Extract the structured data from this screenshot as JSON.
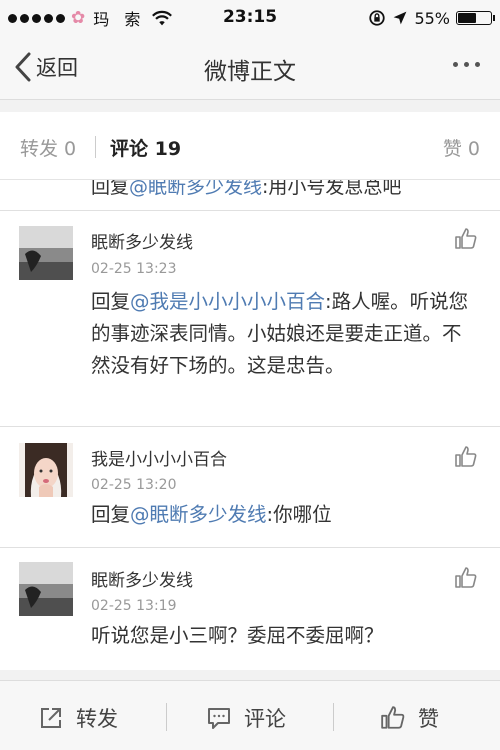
{
  "status_bar": {
    "carrier": "玛 索",
    "time": "23:15",
    "battery": "55%",
    "battery_level": 0.55
  },
  "nav": {
    "back_label": "返回",
    "title": "微博正文"
  },
  "tabs": {
    "repost": "转发 0",
    "comment_label": "评论",
    "comment_count": "19",
    "like": "赞 0"
  },
  "partial_comment": {
    "prefix": "回复",
    "mention": "@眠断多少发线",
    "text": ":用小号发息总吧"
  },
  "comments": [
    {
      "name": "眠断多少发线",
      "time": "02-25 13:23",
      "prefix": "回复",
      "mention": "@我是小小小小小百合",
      "text": ":路人喔。听说您的事迹深表同情。小姑娘还是要走正道。不然没有好下场的。这是忠告。"
    },
    {
      "name": "我是小小小小百合",
      "time": "02-25 13:20",
      "prefix": "回复",
      "mention": "@眠断多少发线",
      "text": ":你哪位"
    },
    {
      "name": "眠断多少发线",
      "time": "02-25 13:19",
      "prefix": "",
      "mention": "",
      "text": "听说您是小三啊？委屈不委屈啊？"
    }
  ],
  "toolbar": {
    "repost": "转发",
    "comment": "评论",
    "like": "赞"
  },
  "colors": {
    "mention": "#4f7bb2",
    "background": "#f2f2f2"
  }
}
